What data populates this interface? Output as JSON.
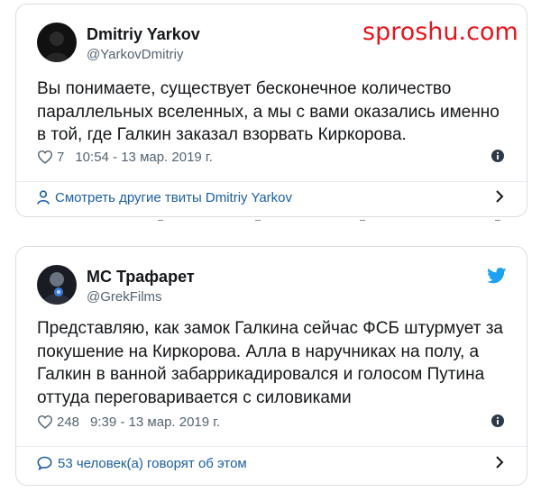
{
  "watermark": "sproshu.com",
  "tweets": [
    {
      "author_name": "Dmitriy Yarkov",
      "author_handle": "@YarkovDmitriy",
      "text": "Вы понимаете, существует бесконечное количество параллельных вселенных, а мы с вами оказались именно в той, где Галкин заказал взорвать Киркорова.",
      "likes": "7",
      "timestamp": "10:54 - 13 мар. 2019 г.",
      "footer_label": "Смотреть другие твиты Dmitriy Yarkov",
      "icons": [
        "avatar",
        "heart-icon",
        "info-icon",
        "person-icon",
        "chevron-right-icon"
      ]
    },
    {
      "author_name": "MC Трафарет",
      "author_handle": "@GrekFilms",
      "text": "Представляю, как замок Галкина сейчас ФСБ штурмует за покушение на Киркорова. Алла в наручниках на полу, а Галкин в ванной забаррикадировался и голосом Путина оттуда переговаривается с силовиками",
      "likes": "248",
      "timestamp": "9:39 - 13 мар. 2019 г.",
      "footer_label": "53 человек(а) говорят об этом",
      "icons": [
        "avatar",
        "twitter-bird-icon",
        "heart-icon",
        "info-icon",
        "speech-bubble-icon",
        "chevron-right-icon"
      ]
    }
  ],
  "colors": {
    "watermark": "#e8141c",
    "link": "#1d5fa3",
    "twitter_blue": "#1da1f2",
    "secondary_text": "#536471",
    "border": "#d9dee3"
  }
}
